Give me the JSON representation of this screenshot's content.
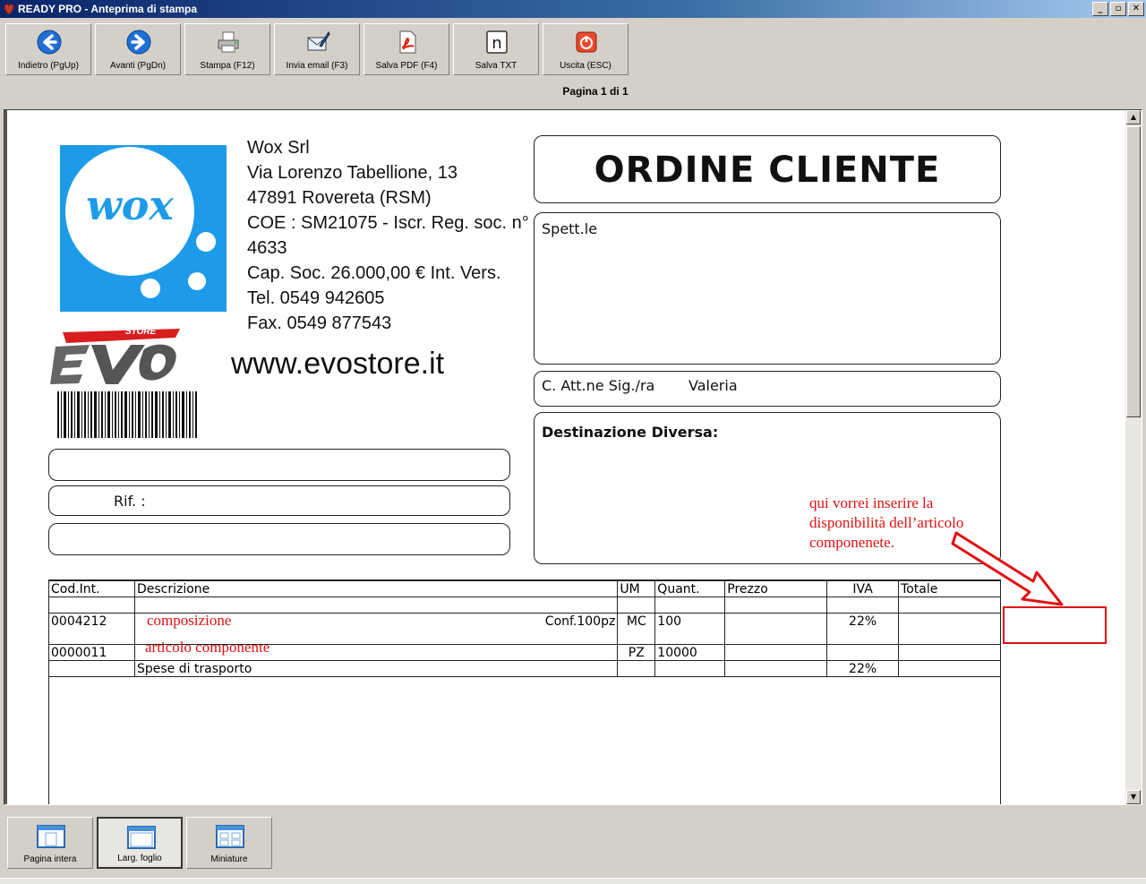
{
  "window": {
    "title": "READY PRO - Anteprima di stampa",
    "controls": [
      "_",
      "▫",
      "✕"
    ]
  },
  "toolbar": [
    {
      "id": "back",
      "label": "Indietro (PgUp)",
      "icon": "arrow-left-icon"
    },
    {
      "id": "forward",
      "label": "Avanti (PgDn)",
      "icon": "arrow-right-icon"
    },
    {
      "id": "print",
      "label": "Stampa (F12)",
      "icon": "printer-icon"
    },
    {
      "id": "email",
      "label": "Invia email (F3)",
      "icon": "email-icon"
    },
    {
      "id": "pdf",
      "label": "Salva PDF (F4)",
      "icon": "pdf-icon"
    },
    {
      "id": "txt",
      "label": "Salva TXT",
      "icon": "notepad-icon"
    },
    {
      "id": "exit",
      "label": "Uscita (ESC)",
      "icon": "power-icon"
    }
  ],
  "page_info": "Pagina 1 di 1",
  "document": {
    "logo_text": "wox",
    "company_lines": [
      "Wox Srl",
      "Via Lorenzo Tabellione, 13",
      "47891 Rovereta (RSM)",
      "COE : SM21075 - Iscr. Reg. soc. n°",
      "4633",
      "Cap. Soc. 26.000,00 € Int. Vers.",
      "Tel. 0549 942605",
      "Fax. 0549 877543"
    ],
    "evo_logo_text": "EVO",
    "evo_logo_sub": "STORE",
    "website": "www.evostore.it",
    "rif_label": "Rif. :",
    "doc_title": "ORDINE CLIENTE",
    "spett_label": "Spett.le",
    "att_label": "C. Att.ne Sig./ra",
    "att_name": "Valeria",
    "dest_label": "Destinazione Diversa:",
    "table": {
      "headers": [
        "Cod.Int.",
        "Descrizione",
        "UM",
        "Quant.",
        "Prezzo",
        "IVA",
        "Totale"
      ],
      "rows": [
        [
          "",
          "",
          "",
          "",
          "",
          "",
          ""
        ],
        [
          "0004212",
          "Conf.100pz",
          "MC",
          "100",
          "",
          "22%",
          ""
        ],
        [
          "",
          "",
          "",
          "",
          "",
          "",
          ""
        ],
        [
          "0000011",
          "",
          "PZ",
          "10000",
          "",
          "",
          ""
        ],
        [
          "",
          "Spese di trasporto",
          "",
          "",
          "",
          "22%",
          ""
        ]
      ]
    }
  },
  "annotations": {
    "composizione": "composizione",
    "articolo": "articolo componente",
    "note_lines": [
      "qui vorrei inserire la",
      "disponibilità dell’articolo",
      "componenete."
    ]
  },
  "bottom_buttons": [
    {
      "label": "Pagina intera",
      "icon": "full-page-icon",
      "active": false
    },
    {
      "label": "Larg. foglio",
      "icon": "page-width-icon",
      "active": true
    },
    {
      "label": "Miniature",
      "icon": "thumbnails-icon",
      "active": false
    }
  ],
  "colors": {
    "annotation": "#e01010",
    "logo_blue": "#1e9be8",
    "title_bar": "#0a246a"
  }
}
